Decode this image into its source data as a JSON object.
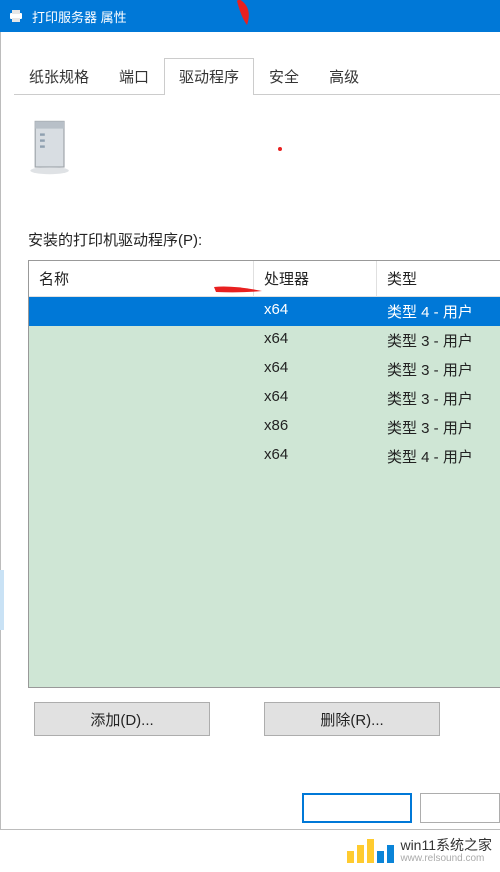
{
  "titlebar": {
    "title": "打印服务器 属性"
  },
  "tabs": [
    {
      "label": "纸张规格"
    },
    {
      "label": "端口"
    },
    {
      "label": "驱动程序"
    },
    {
      "label": "安全"
    },
    {
      "label": "高级"
    }
  ],
  "section_label": "安装的打印机驱动程序(P):",
  "columns": {
    "name": "名称",
    "proc": "处理器",
    "type": "类型"
  },
  "rows": [
    {
      "name": "",
      "proc": "x64",
      "type": "类型 4 - 用户",
      "selected": true
    },
    {
      "name": "",
      "proc": "x64",
      "type": "类型 3 - 用户",
      "selected": false
    },
    {
      "name": "",
      "proc": "x64",
      "type": "类型 3 - 用户",
      "selected": false
    },
    {
      "name": "",
      "proc": "x64",
      "type": "类型 3 - 用户",
      "selected": false
    },
    {
      "name": "",
      "proc": "x86",
      "type": "类型 3 - 用户",
      "selected": false
    },
    {
      "name": "",
      "proc": "x64",
      "type": "类型 4 - 用户",
      "selected": false
    }
  ],
  "buttons": {
    "add": "添加(D)...",
    "remove": "删除(R)..."
  },
  "watermark": {
    "line1": "win11系统之家",
    "line2": "www.relsound.com"
  }
}
